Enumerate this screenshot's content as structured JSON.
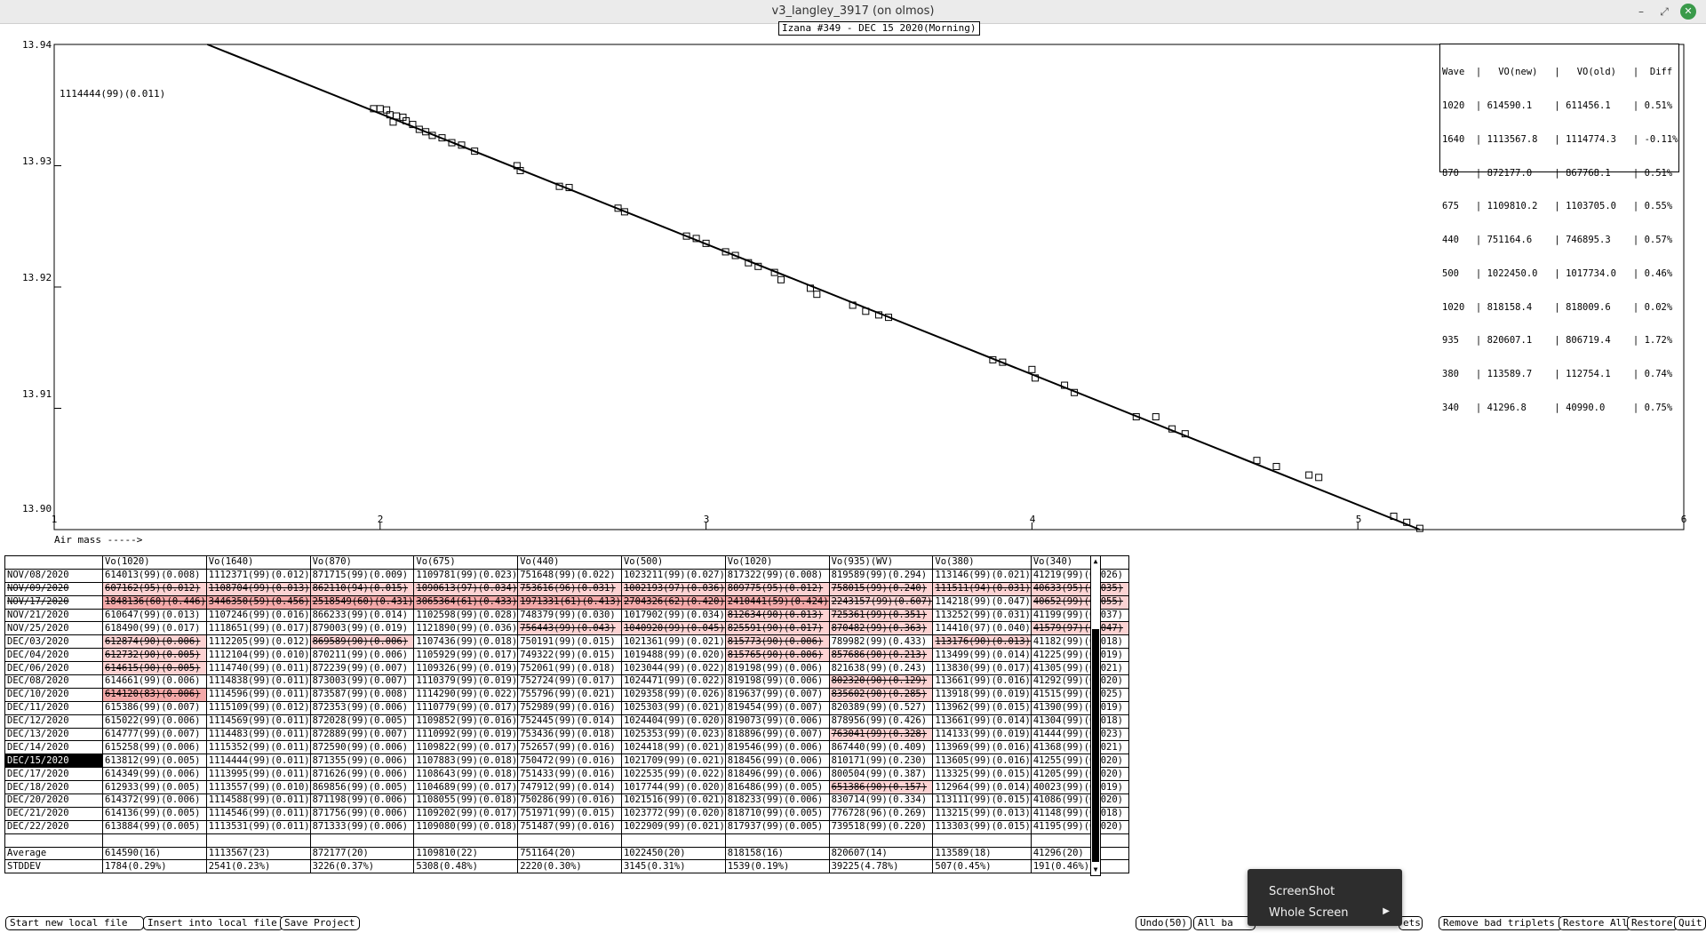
{
  "window": {
    "title": "v3_langley_3917 (on olmos)",
    "minimize_glyph": "–",
    "maximize_glyph": "⤢",
    "close_glyph": "✕"
  },
  "plot": {
    "title": "Izana #349 - DEC 15 2020(Morning)",
    "point_label": "1114444(99)(0.011)",
    "x_caption": "Air mass ----->",
    "y_ticks": [
      "13.94",
      "13.93",
      "13.92",
      "13.91",
      "13.90"
    ],
    "x_ticks": [
      "1",
      "2",
      "3",
      "4",
      "5",
      "6"
    ]
  },
  "chart_data": {
    "type": "scatter",
    "title": "Izana #349 - DEC 15 2020(Morning)",
    "xlabel": "Air mass ----->",
    "ylabel": "",
    "xlim": [
      1,
      6
    ],
    "ylim": [
      13.9,
      13.94
    ],
    "fit_line": {
      "x": [
        1.47,
        5.19
      ],
      "y": [
        13.94,
        13.9
      ]
    },
    "points": [
      [
        1.98,
        13.9347
      ],
      [
        2.0,
        13.9347
      ],
      [
        2.02,
        13.9346
      ],
      [
        2.03,
        13.9342
      ],
      [
        2.04,
        13.9336
      ],
      [
        2.05,
        13.9341
      ],
      [
        2.07,
        13.934
      ],
      [
        2.08,
        13.9337
      ],
      [
        2.1,
        13.9334
      ],
      [
        2.12,
        13.933
      ],
      [
        2.14,
        13.9328
      ],
      [
        2.16,
        13.9325
      ],
      [
        2.19,
        13.9323
      ],
      [
        2.22,
        13.9319
      ],
      [
        2.25,
        13.9317
      ],
      [
        2.29,
        13.9312
      ],
      [
        2.42,
        13.93
      ],
      [
        2.43,
        13.9296
      ],
      [
        2.55,
        13.9283
      ],
      [
        2.58,
        13.9282
      ],
      [
        2.73,
        13.9265
      ],
      [
        2.75,
        13.9262
      ],
      [
        2.94,
        13.9242
      ],
      [
        2.97,
        13.924
      ],
      [
        3.0,
        13.9236
      ],
      [
        3.06,
        13.9229
      ],
      [
        3.09,
        13.9226
      ],
      [
        3.13,
        13.922
      ],
      [
        3.16,
        13.9217
      ],
      [
        3.21,
        13.9212
      ],
      [
        3.23,
        13.9206
      ],
      [
        3.32,
        13.9199
      ],
      [
        3.34,
        13.9194
      ],
      [
        3.45,
        13.9185
      ],
      [
        3.49,
        13.918
      ],
      [
        3.53,
        13.9177
      ],
      [
        3.56,
        13.9175
      ],
      [
        3.88,
        13.914
      ],
      [
        3.91,
        13.9138
      ],
      [
        4.0,
        13.9132
      ],
      [
        4.01,
        13.9125
      ],
      [
        4.1,
        13.9119
      ],
      [
        4.13,
        13.9113
      ],
      [
        4.32,
        13.9093
      ],
      [
        4.38,
        13.9093
      ],
      [
        4.43,
        13.9083
      ],
      [
        4.47,
        13.9079
      ],
      [
        4.69,
        13.9057
      ],
      [
        4.75,
        13.9052
      ],
      [
        4.85,
        13.9045
      ],
      [
        4.88,
        13.9043
      ],
      [
        5.11,
        13.9011
      ],
      [
        5.15,
        13.9006
      ],
      [
        5.19,
        13.9001
      ]
    ]
  },
  "legend": {
    "header": "Wave  |   VO(new)   |   VO(old)   |  Diff",
    "rows": [
      "1020  | 614590.1    | 611456.1    | 0.51%",
      "1640  | 1113567.8   | 1114774.3   | -0.11%",
      "870   | 872177.0    | 867768.1    | 0.51%",
      "675   | 1109810.2   | 1103705.0   | 0.55%",
      "440   | 751164.6    | 746895.3    | 0.57%",
      "500   | 1022450.0   | 1017734.0   | 0.46%",
      "1020  | 818158.4    | 818009.6    | 0.02%",
      "935   | 820607.1    | 806719.4    | 1.72%",
      "380   | 113589.7    | 112754.1    | 0.74%",
      "340   | 41296.8     | 40990.0     | 0.75%"
    ]
  },
  "table": {
    "columns": [
      "",
      "Vo(1020)",
      "Vo(1640)",
      "Vo(870)",
      "Vo(675)",
      "Vo(440)",
      "Vo(500)",
      "Vo(1020)",
      "Vo(935)(WV)",
      "Vo(380)",
      "Vo(340)"
    ],
    "rows": [
      {
        "date": "NOV/08/2020",
        "cells": [
          "614013(99)(0.008)",
          "1112371(99)(0.012)",
          "871715(99)(0.009)",
          "1109781(99)(0.023)",
          "751648(99)(0.022)",
          "1023211(99)(0.027)",
          "817322(99)(0.008)",
          "819589(99)(0.294)",
          "113146(99)(0.021)",
          "41219(99)(0.026)"
        ],
        "marks": "..........",
        "strike": false
      },
      {
        "date": "NOV/09/2020",
        "cells": [
          "607162(95)(0.012)",
          "1108704(99)(0.013)",
          "862110(94)(0.015)",
          "1090613(97)(0.034)",
          "753616(96)(0.031)",
          "1002193(97)(0.036)",
          "809775(95)(0.012)",
          "758015(99)(0.240)",
          "111511(94)(0.031)",
          "40633(95)(0.035)"
        ],
        "marks": "pppppppppp",
        "strike": true
      },
      {
        "date": "NOV/17/2020",
        "cells": [
          "1848136(60)(0.446)",
          "3446350(59)(0.456)",
          "2518549(60)(0.431)",
          "3065364(61)(0.433)",
          "1971331(61)(0.413)",
          "2704326(62)(0.420)",
          "2410441(59)(0.424)",
          "2243157(99)(0.607)",
          "114218(99)(0.047)",
          "40652(99)(0.055)"
        ],
        "marks": "rrrrrrrp.p",
        "strike": true
      },
      {
        "date": "NOV/21/2020",
        "cells": [
          "610647(99)(0.013)",
          "1107246(99)(0.016)",
          "866233(99)(0.014)",
          "1102598(99)(0.028)",
          "748379(99)(0.030)",
          "1017902(99)(0.034)",
          "812634(90)(0.013)",
          "725361(99)(0.351)",
          "113252(99)(0.031)",
          "41199(99)(0.037)"
        ],
        "marks": "......pp..",
        "strike": false
      },
      {
        "date": "NOV/25/2020",
        "cells": [
          "618490(99)(0.017)",
          "1118651(99)(0.017)",
          "879003(99)(0.019)",
          "1121890(99)(0.036)",
          "756443(99)(0.043)",
          "1040920(99)(0.045)",
          "825591(90)(0.017)",
          "870482(99)(0.363)",
          "114410(97)(0.040)",
          "41579(97)(0.047)"
        ],
        "marks": "....pppp.p",
        "strike": false
      },
      {
        "date": "DEC/03/2020",
        "cells": [
          "612874(90)(0.006)",
          "1112205(99)(0.012)",
          "869589(90)(0.006)",
          "1107436(99)(0.018)",
          "750191(99)(0.015)",
          "1021361(99)(0.021)",
          "815773(90)(0.006)",
          "789982(99)(0.433)",
          "113176(90)(0.013)",
          "41182(99)(0.018)"
        ],
        "marks": "p.p...p.p.",
        "strike": false
      },
      {
        "date": "DEC/04/2020",
        "cells": [
          "612732(90)(0.005)",
          "1112104(99)(0.010)",
          "870211(99)(0.006)",
          "1105929(99)(0.017)",
          "749322(99)(0.015)",
          "1019488(99)(0.020)",
          "815765(90)(0.006)",
          "857686(90)(0.213)",
          "113499(99)(0.014)",
          "41225(99)(0.019)"
        ],
        "marks": "p.....pp..",
        "strike": false
      },
      {
        "date": "DEC/06/2020",
        "cells": [
          "614615(90)(0.005)",
          "1114740(99)(0.011)",
          "872239(99)(0.007)",
          "1109326(99)(0.019)",
          "752061(99)(0.018)",
          "1023044(99)(0.022)",
          "819198(99)(0.006)",
          "821638(99)(0.243)",
          "113830(99)(0.017)",
          "41305(99)(0.021)"
        ],
        "marks": "p.........",
        "strike": false
      },
      {
        "date": "DEC/08/2020",
        "cells": [
          "614661(99)(0.006)",
          "1114838(99)(0.011)",
          "873003(99)(0.007)",
          "1110379(99)(0.019)",
          "752724(99)(0.017)",
          "1024471(99)(0.022)",
          "819198(99)(0.006)",
          "802320(90)(0.129)",
          "113661(99)(0.016)",
          "41292(99)(0.020)"
        ],
        "marks": ".......p..",
        "strike": false
      },
      {
        "date": "DEC/10/2020",
        "cells": [
          "614120(83)(0.006)",
          "1114596(99)(0.011)",
          "873587(99)(0.008)",
          "1114290(99)(0.022)",
          "755796(99)(0.021)",
          "1029358(99)(0.026)",
          "819637(99)(0.007)",
          "835602(90)(0.285)",
          "113918(99)(0.019)",
          "41515(99)(0.025)"
        ],
        "marks": "r......p..",
        "strike": false
      },
      {
        "date": "DEC/11/2020",
        "cells": [
          "615386(99)(0.007)",
          "1115109(99)(0.012)",
          "872353(99)(0.006)",
          "1110779(99)(0.017)",
          "752989(99)(0.016)",
          "1025303(99)(0.021)",
          "819454(99)(0.007)",
          "820389(99)(0.527)",
          "113962(99)(0.015)",
          "41390(99)(0.019)"
        ],
        "marks": "..........",
        "strike": false
      },
      {
        "date": "DEC/12/2020",
        "cells": [
          "615022(99)(0.006)",
          "1114569(99)(0.011)",
          "872028(99)(0.005)",
          "1109852(99)(0.016)",
          "752445(99)(0.014)",
          "1024404(99)(0.020)",
          "819073(99)(0.006)",
          "878956(99)(0.426)",
          "113661(99)(0.014)",
          "41304(99)(0.018)"
        ],
        "marks": "..........",
        "strike": false
      },
      {
        "date": "DEC/13/2020",
        "cells": [
          "614777(99)(0.007)",
          "1114483(99)(0.011)",
          "872889(99)(0.007)",
          "1110992(99)(0.019)",
          "753436(99)(0.018)",
          "1025353(99)(0.023)",
          "818896(99)(0.007)",
          "763041(99)(0.328)",
          "114133(99)(0.019)",
          "41444(99)(0.023)"
        ],
        "marks": ".......p..",
        "strike": false
      },
      {
        "date": "DEC/14/2020",
        "cells": [
          "615258(99)(0.006)",
          "1115352(99)(0.011)",
          "872590(99)(0.006)",
          "1109822(99)(0.017)",
          "752657(99)(0.016)",
          "1024418(99)(0.021)",
          "819546(99)(0.006)",
          "867440(99)(0.409)",
          "113969(99)(0.016)",
          "41368(99)(0.021)"
        ],
        "marks": "..........",
        "strike": false
      },
      {
        "date": "DEC/15/2020",
        "cells": [
          "613812(99)(0.005)",
          "1114444(99)(0.011)",
          "871355(99)(0.006)",
          "1107883(99)(0.018)",
          "750472(99)(0.016)",
          "1021709(99)(0.021)",
          "818456(99)(0.006)",
          "810171(99)(0.230)",
          "113605(99)(0.016)",
          "41255(99)(0.020)"
        ],
        "marks": "..........",
        "strike": false,
        "selected": true
      },
      {
        "date": "DEC/17/2020",
        "cells": [
          "614349(99)(0.006)",
          "1113995(99)(0.011)",
          "871626(99)(0.006)",
          "1108643(99)(0.018)",
          "751433(99)(0.016)",
          "1022535(99)(0.022)",
          "818496(99)(0.006)",
          "800504(99)(0.387)",
          "113325(99)(0.015)",
          "41205(99)(0.020)"
        ],
        "marks": "..........",
        "strike": false
      },
      {
        "date": "DEC/18/2020",
        "cells": [
          "612933(99)(0.005)",
          "1113557(99)(0.010)",
          "869856(99)(0.005)",
          "1104689(99)(0.017)",
          "747912(99)(0.014)",
          "1017744(99)(0.020)",
          "816486(99)(0.005)",
          "651386(90)(0.157)",
          "112964(99)(0.014)",
          "40023(99)(0.019)"
        ],
        "marks": ".......p..",
        "strike": false
      },
      {
        "date": "DEC/20/2020",
        "cells": [
          "614372(99)(0.006)",
          "1114588(99)(0.011)",
          "871198(99)(0.006)",
          "1108055(99)(0.018)",
          "750286(99)(0.016)",
          "1021516(99)(0.021)",
          "818233(99)(0.006)",
          "830714(99)(0.334)",
          "113111(99)(0.015)",
          "41086(99)(0.020)"
        ],
        "marks": "..........",
        "strike": false
      },
      {
        "date": "DEC/21/2020",
        "cells": [
          "614136(99)(0.005)",
          "1114546(99)(0.011)",
          "871756(99)(0.006)",
          "1109202(99)(0.017)",
          "751971(99)(0.015)",
          "1023772(99)(0.020)",
          "818710(99)(0.005)",
          "776728(96)(0.269)",
          "113215(99)(0.013)",
          "41148(99)(0.018)"
        ],
        "marks": "..........",
        "strike": false
      },
      {
        "date": "DEC/22/2020",
        "cells": [
          "613884(99)(0.005)",
          "1113531(99)(0.011)",
          "871333(99)(0.006)",
          "1109080(99)(0.018)",
          "751487(99)(0.016)",
          "1022909(99)(0.021)",
          "817937(99)(0.005)",
          "739518(99)(0.220)",
          "113303(99)(0.015)",
          "41195(99)(0.020)"
        ],
        "marks": "..........",
        "strike": false
      }
    ],
    "average": {
      "label": "Average",
      "cells": [
        "614590(16)",
        "1113567(23)",
        "872177(20)",
        "1109810(22)",
        "751164(20)",
        "1022450(20)",
        "818158(16)",
        "820607(14)",
        "113589(18)",
        "41296(20)"
      ]
    },
    "stddev": {
      "label": "STDDEV",
      "cells": [
        "1784(0.29%)",
        "2541(0.23%)",
        "3226(0.37%)",
        "5308(0.48%)",
        "2220(0.30%)",
        "3145(0.31%)",
        "1539(0.19%)",
        "39225(4.78%)",
        " 507(0.45%)",
        " 191(0.46%)"
      ]
    }
  },
  "buttons": {
    "start_new": "Start new local file",
    "insert": "Insert into local file",
    "save_project": "Save Project",
    "undo": "Undo(50)",
    "all_bad_partial": "All ba",
    "triplets_partial": "ets",
    "remove_bad": "Remove bad triplets",
    "restore_all": "Restore All",
    "restore": "Restore",
    "quit": "Quit"
  },
  "context_menu": {
    "item1": "ScreenShot",
    "item2": "Whole Screen",
    "submenu_arrow": "▶"
  },
  "colors": {
    "bad_cell": "#f4a9a9",
    "flag_cell": "#fcd3d3",
    "selected": "#000000",
    "menu_bg": "#2d2d2d",
    "close_btn": "#3a9a4a"
  }
}
